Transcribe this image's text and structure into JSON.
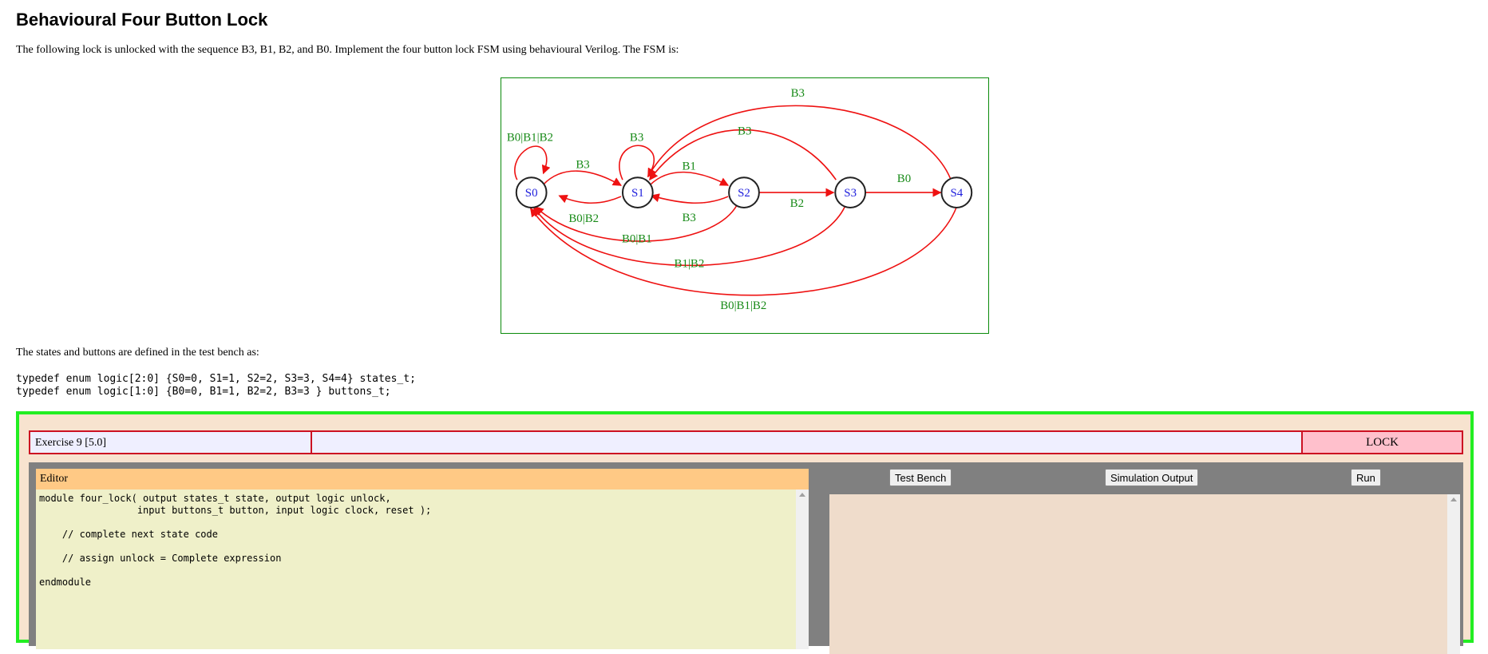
{
  "page": {
    "title": "Behavioural Four Button Lock",
    "intro": "The following lock is unlocked with the sequence B3, B1, B2, and B0. Implement the four button lock FSM using behavioural Verilog. The FSM is:",
    "defs_intro": "The states and buttons are defined in the test bench as:",
    "typedef_states": "typedef enum logic[2:0] {S0=0, S1=1, S2=2, S3=3, S4=4} states_t;",
    "typedef_buttons": "typedef enum logic[1:0] {B0=0, B1=1, B2=2, B3=3 } buttons_t;"
  },
  "fsm": {
    "states": [
      "S0",
      "S1",
      "S2",
      "S3",
      "S4"
    ],
    "transitions": [
      {
        "from": "S0",
        "to": "S0",
        "label": "B0|B1|B2"
      },
      {
        "from": "S0",
        "to": "S1",
        "label": "B3"
      },
      {
        "from": "S1",
        "to": "S0",
        "label": "B0|B2"
      },
      {
        "from": "S1",
        "to": "S1",
        "label": "B3"
      },
      {
        "from": "S1",
        "to": "S2",
        "label": "B1"
      },
      {
        "from": "S2",
        "to": "S1",
        "label": "B3"
      },
      {
        "from": "S2",
        "to": "S0",
        "label": "B0|B1"
      },
      {
        "from": "S2",
        "to": "S3",
        "label": "B2"
      },
      {
        "from": "S3",
        "to": "S1",
        "label": "B3"
      },
      {
        "from": "S3",
        "to": "S0",
        "label": "B1|B2"
      },
      {
        "from": "S3",
        "to": "S4",
        "label": "B0"
      },
      {
        "from": "S4",
        "to": "S1",
        "label": "B3"
      },
      {
        "from": "S4",
        "to": "S0",
        "label": "B0|B1|B2"
      }
    ]
  },
  "exercise": {
    "title": "Exercise 9 [5.0]",
    "status": "",
    "lock_label": "LOCK",
    "editor_label": "Editor",
    "code": "module four_lock( output states_t state, output logic unlock,\n                 input buttons_t button, input logic clock, reset );\n\n    // complete next state code\n\n    // assign unlock = Complete expression\n\nendmodule",
    "buttons": {
      "test_bench": "Test Bench",
      "sim_output": "Simulation Output",
      "run": "Run"
    },
    "output_text": ""
  }
}
